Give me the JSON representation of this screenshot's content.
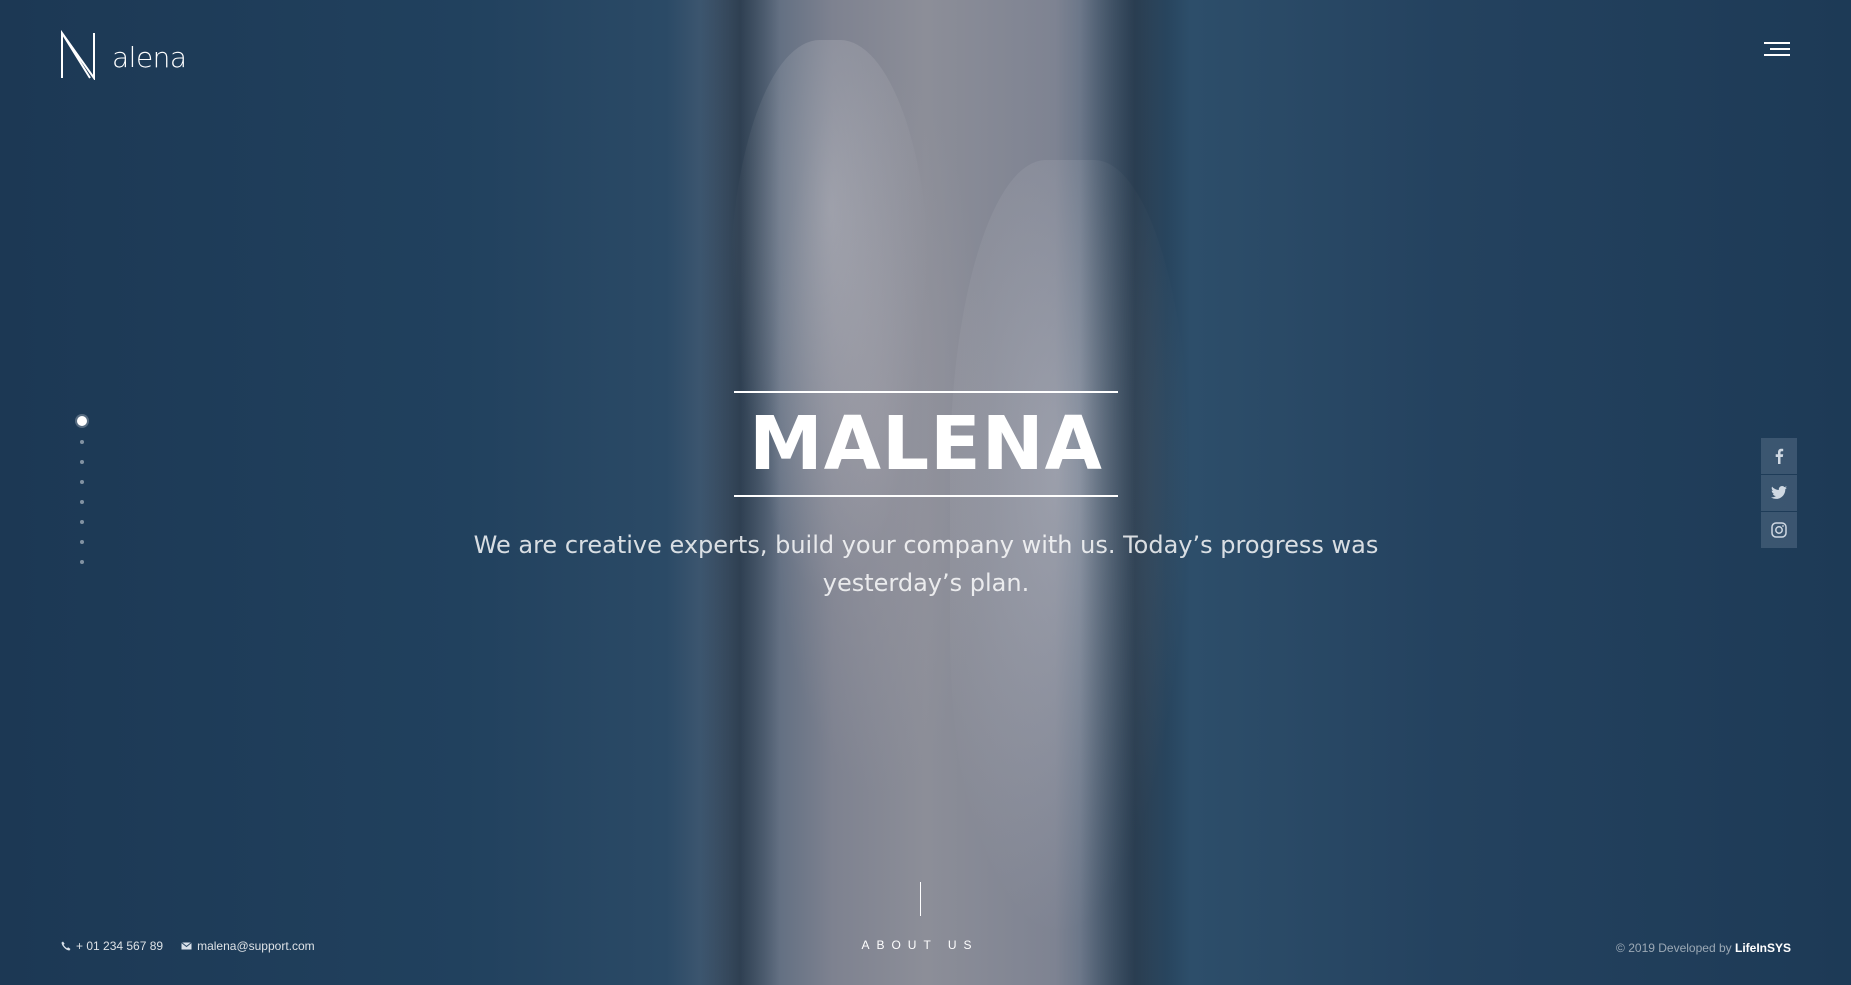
{
  "brand": {
    "logo_text": "alena"
  },
  "nav": {
    "menu_icon": "hamburger-menu-icon"
  },
  "slider": {
    "dot_count": 8,
    "active_index": 0
  },
  "hero": {
    "title": "MALENA",
    "subtitle": "We are creative experts, build your company with us. Today’s progress was yesterday’s plan."
  },
  "social": {
    "items": [
      {
        "icon": "facebook-icon"
      },
      {
        "icon": "twitter-icon"
      },
      {
        "icon": "instagram-icon"
      }
    ]
  },
  "about": {
    "label": "ABOUT US"
  },
  "footer": {
    "phone": "+ 01 234 567 89",
    "email": "malena@support.com",
    "copyright_prefix": "© 2019 Developed by",
    "developer": "LifeInSYS"
  },
  "colors": {
    "background": "#1d3a56",
    "text": "#ffffff"
  }
}
